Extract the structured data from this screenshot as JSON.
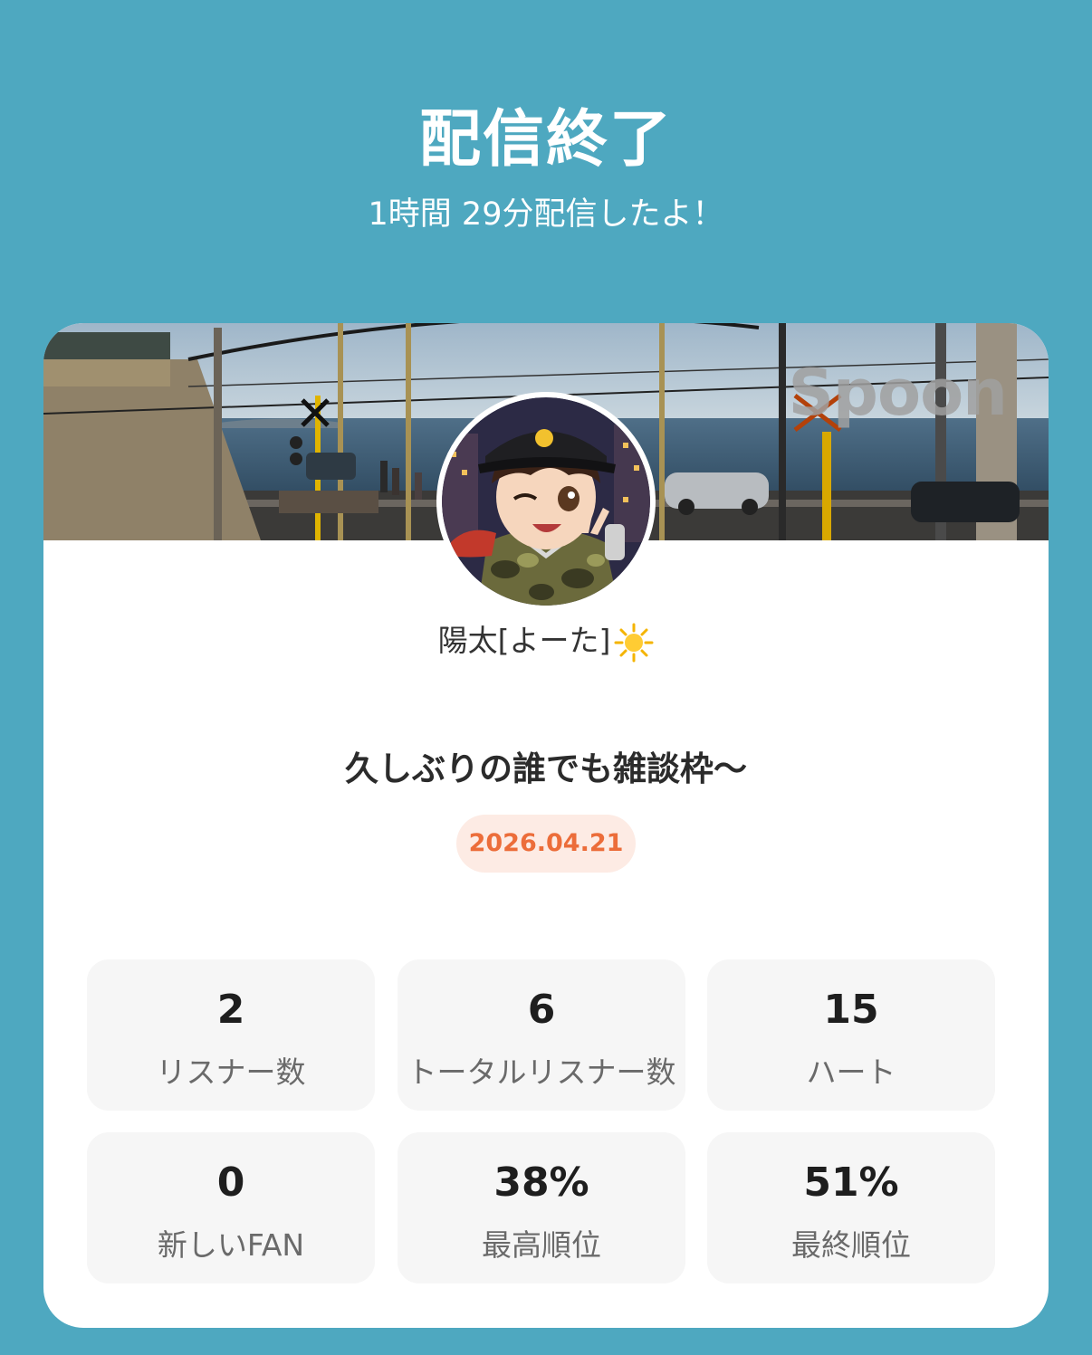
{
  "header": {
    "title": "配信終了",
    "subtitle": "1時間 29分配信したよ！"
  },
  "card": {
    "brand": "Spoon",
    "username": "陽太[よーた]",
    "username_icon": "sun-emoji-icon",
    "live_title": "久しぶりの誰でも雑談枠〜",
    "date": "2026.04.21",
    "stats": [
      {
        "value": "2",
        "label": "リスナー数"
      },
      {
        "value": "6",
        "label": "トータルリスナー数"
      },
      {
        "value": "15",
        "label": "ハート"
      },
      {
        "value": "0",
        "label": "新しいFAN"
      },
      {
        "value": "38%",
        "label": "最高順位"
      },
      {
        "value": "51%",
        "label": "最終順位"
      }
    ]
  },
  "colors": {
    "background": "#4ea8c0",
    "card": "#ffffff",
    "date_pill_bg": "#fdebe4",
    "date_text": "#ec6d3a",
    "stat_bg": "#f6f6f6"
  }
}
